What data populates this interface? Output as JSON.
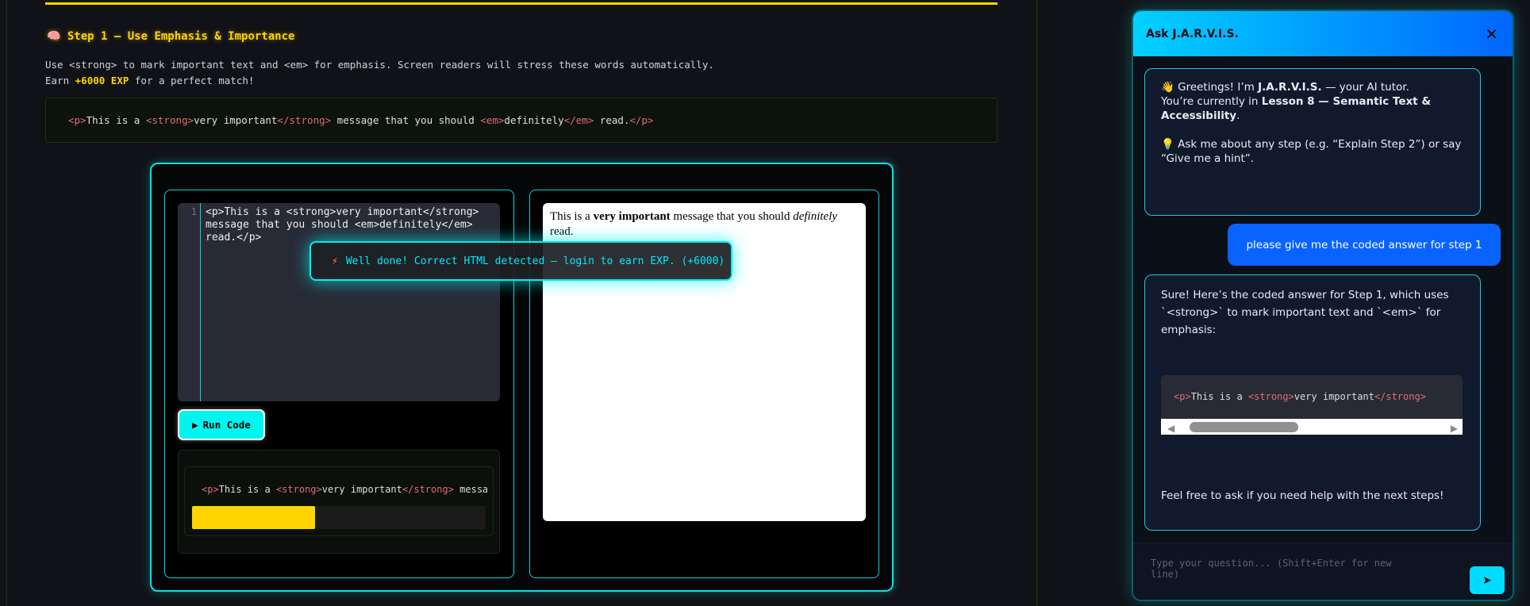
{
  "lesson": {
    "step_title": "Step 1 – Use Emphasis & Importance",
    "step_icon": "brain-icon",
    "description_line1": "Use <strong> to mark important text and <em> for emphasis. Screen readers will stress these words automatically.",
    "description_earn_prefix": "Earn ",
    "description_exp": "+6000 EXP",
    "description_earn_suffix": " for a perfect match!",
    "example_code": {
      "p_open": "<p>",
      "t1": "This is a ",
      "strong_open": "<strong>",
      "t2": "very important",
      "strong_close": "</strong>",
      "t3": " message that you should ",
      "em_open": "<em>",
      "t4": "definitely",
      "em_close": "</em>",
      "t5": " read.",
      "p_close": "</p>"
    }
  },
  "editor": {
    "line_number": "1",
    "code": "<p>This is a <strong>very important</strong> message that you should <em>definitely</em> read.</p>",
    "run_label": "Run Code",
    "output_code": {
      "p_open": "<p>",
      "t1": "This is a ",
      "strong_open": "<strong>",
      "t2": "very important",
      "strong_close": "</strong>",
      "t3": " messag"
    },
    "progress_fraction": 0.42,
    "progress_color": "#ffd500"
  },
  "preview": {
    "t1": "This is a ",
    "strong": "very important",
    "t2": " message that you should ",
    "em": "definitely",
    "t3": " read."
  },
  "toast": {
    "icon": "lightning-icon",
    "text": "Well done! Correct HTML detected – login to earn EXP. (+6000)"
  },
  "chat": {
    "title": "Ask J.A.R.V.I.S.",
    "messages": [
      {
        "role": "bot",
        "g1": "Greetings! I’m ",
        "g_name": "J.A.R.V.I.S.",
        "g2": " — your AI tutor.",
        "g3": "You’re currently in ",
        "g_lesson": "Lesson 8 — Semantic Text & Accessibility",
        "g4": ".",
        "tip": "Ask me about any step (e.g. “Explain Step 2”) or say “Give me a hint”."
      },
      {
        "role": "user",
        "text": "please give me the coded answer for step 1"
      },
      {
        "role": "bot",
        "intro": "Sure! Here’s the coded answer for Step 1, which uses `<strong>` to mark important text and `<em>` for emphasis:",
        "code": {
          "p_open": "<p>",
          "t1": "This is a ",
          "strong_open": "<strong>",
          "t2": "very important",
          "strong_close": "</strong>"
        },
        "outro": "Feel free to ask if you need help with the next steps!"
      }
    ],
    "input_placeholder": "Type your question... (Shift+Enter for new line)",
    "accent": "#00d2ff",
    "user_bubble_color": "#0a63ff"
  }
}
